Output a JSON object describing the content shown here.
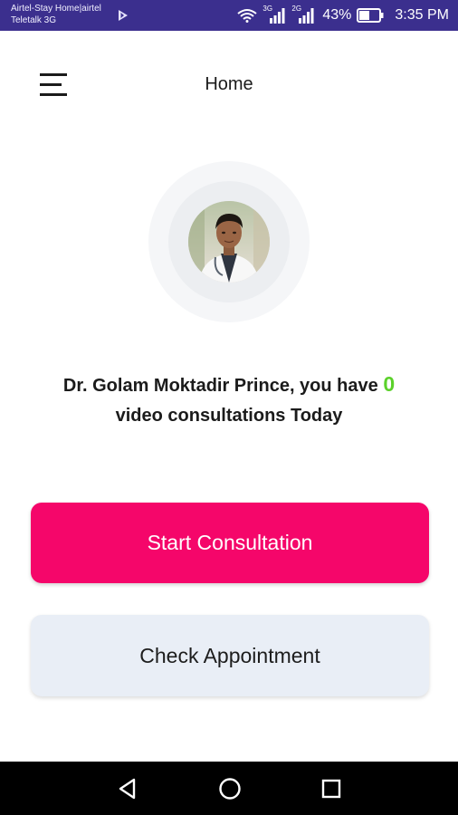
{
  "status_bar": {
    "carrier_line1": "Airtel-Stay Home|airtel",
    "carrier_line2": "Teletalk 3G",
    "network1": "3G",
    "network2": "2G",
    "battery": "43%",
    "time": "3:35 PM"
  },
  "app_bar": {
    "title": "Home"
  },
  "greeting": {
    "prefix": "Dr. Golam Moktadir Prince, you have ",
    "count": "0",
    "suffix": "video consultations Today"
  },
  "actions": {
    "start_label": "Start Consultation",
    "check_label": "Check Appointment"
  },
  "colors": {
    "status_bar": "#3b2f8e",
    "primary": "#f5066a",
    "secondary": "#e9eef6",
    "count": "#5bd12b"
  }
}
